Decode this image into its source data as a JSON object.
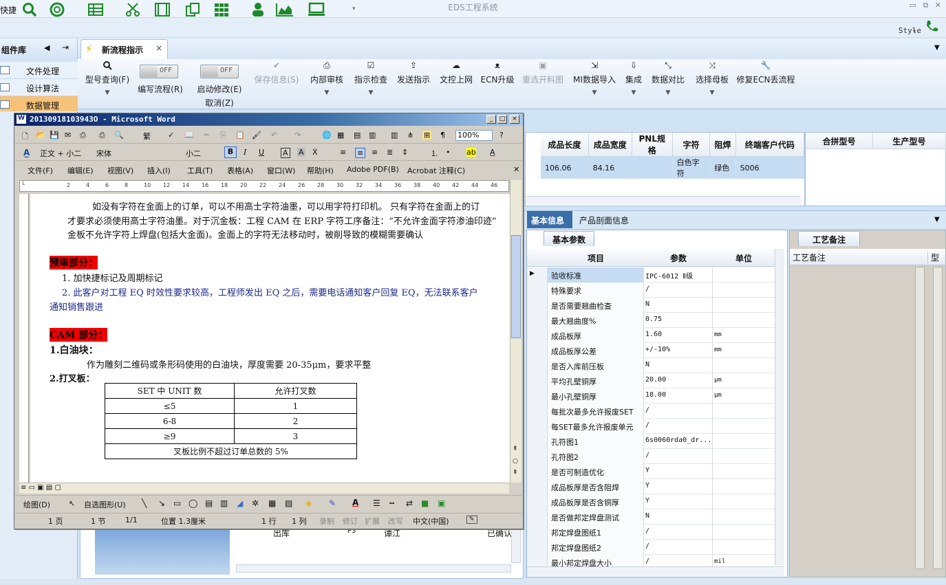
{
  "app": {
    "quick_label": "快捷",
    "title": "EDS工程系统",
    "style_label": "Style"
  },
  "left": {
    "title": "组件库",
    "items": [
      {
        "label": "文件处理"
      },
      {
        "label": "设计算法"
      },
      {
        "label": "数据管理"
      }
    ]
  },
  "tab": {
    "label": "新流程指示"
  },
  "ribbon": {
    "items": [
      {
        "label": "型号查询(F)"
      },
      {
        "label": "编写流程(R)"
      },
      {
        "label": "启动修改(E)",
        "sub": "取消(Z)"
      },
      {
        "label": "保存信息(S)"
      },
      {
        "label": "内部审核"
      },
      {
        "label": "指示检查"
      },
      {
        "label": "发送指示"
      },
      {
        "label": "文控上网"
      },
      {
        "label": "ECN升级"
      },
      {
        "label": "重选开料图"
      },
      {
        "label": "MI数据导入"
      },
      {
        "label": "集成"
      },
      {
        "label": "数据对比"
      },
      {
        "label": "选择母板"
      },
      {
        "label": "修复ECN丢流程"
      }
    ],
    "toggle_off": "OFF"
  },
  "grid1": {
    "headers": [
      "成品长度",
      "成品宽度",
      "PNL规格",
      "字符",
      "阻焊",
      "终端客户代码"
    ],
    "row": [
      "106.06",
      "84.16",
      "",
      "白色字符",
      "绿色",
      "S006"
    ]
  },
  "grid2": {
    "headers": [
      "合拼型号",
      "生产型号"
    ]
  },
  "info_tabs": {
    "basic": "基本信息",
    "profile": "产品剖面信息"
  },
  "props": {
    "tab": "基本参数",
    "headers": {
      "item": "项目",
      "param": "参数",
      "unit": "单位"
    },
    "rows": [
      {
        "n": "验收标准",
        "v": "IPC-6012 Ⅱ级",
        "u": ""
      },
      {
        "n": "特殊要求",
        "v": "/",
        "u": ""
      },
      {
        "n": "是否需要翘曲检查",
        "v": "N",
        "u": ""
      },
      {
        "n": "最大翘曲度%",
        "v": "0.75",
        "u": ""
      },
      {
        "n": "成品板厚",
        "v": "1.60",
        "u": "mm"
      },
      {
        "n": "成品板厚公差",
        "v": "+/-10%",
        "u": "mm"
      },
      {
        "n": "是否入库前压板",
        "v": "N",
        "u": ""
      },
      {
        "n": "平均孔壁铜厚",
        "v": "20.00",
        "u": "μm"
      },
      {
        "n": "最小孔壁铜厚",
        "v": "18.00",
        "u": "μm"
      },
      {
        "n": "每批次最多允许报废SET",
        "v": "/",
        "u": ""
      },
      {
        "n": "每SET最多允许报废单元",
        "v": "/",
        "u": ""
      },
      {
        "n": "孔符图1",
        "v": "6s0060rda0_dr...",
        "u": ""
      },
      {
        "n": "孔符图2",
        "v": "/",
        "u": ""
      },
      {
        "n": "是否可制造优化",
        "v": "Y",
        "u": ""
      },
      {
        "n": "成品板厚是否含阻焊",
        "v": "Y",
        "u": ""
      },
      {
        "n": "成品板厚是否含铜厚",
        "v": "Y",
        "u": ""
      },
      {
        "n": "是否做邦定焊盘测试",
        "v": "N",
        "u": ""
      },
      {
        "n": "邦定焊盘图纸1",
        "v": "/",
        "u": ""
      },
      {
        "n": "邦定焊盘图纸2",
        "v": "/",
        "u": ""
      },
      {
        "n": "最小邦定焊盘大小",
        "v": "/",
        "u": "mil"
      }
    ]
  },
  "craft": {
    "tab": "工艺备注",
    "header": "工艺备注",
    "col2": "型"
  },
  "bg_list": {
    "c1": "出库",
    "c2": "P3",
    "c3": "谭江",
    "c4": "已确认"
  },
  "word": {
    "title": "20130918103943O - Microsoft Word",
    "style_box": "正文 + 小二",
    "font_box": "宋体",
    "size_box": "小二",
    "zoom": "100%",
    "menus": [
      "文件(F)",
      "编辑(E)",
      "视图(V)",
      "插入(I)",
      "工具(T)",
      "表格(A)",
      "窗口(W)",
      "帮助(H)",
      "Adobe PDF(B)",
      "Acrobat 注释(C)"
    ],
    "ruler_marks": [
      "2",
      "4",
      "6",
      "8",
      "10",
      "12",
      "14",
      "16",
      "18",
      "20",
      "22",
      "24",
      "26",
      "28",
      "30",
      "32",
      "34",
      "36",
      "38",
      "40",
      "42",
      "44",
      "46"
    ],
    "body": {
      "p1": "如没有字符在金面上的订单，可以不用高士字符油墨，可以用字符打印机。   只有字符在金面上的订",
      "p2": "才要求必须使用高士字符油墨。对于沉金板：工程 CAM 在 ERP 字符工序备注：“不允许金面字符渗油印迹”",
      "p3": "金板不允许字符上焊盘(包括大金面)。金面上的字符无法移动时，被削导致的模糊需要确认",
      "h1": "预审部分：",
      "l1": "1. 加快捷标记及周期标记",
      "l2": "2. 此客户对工程 EQ 时效性要求较高，工程师发出 EQ 之后，需要电话通知客户回复 EQ，无法联系客户",
      "l2b": "通知销售跟进",
      "h2": "CAM 部分：",
      "s1": "1.白油块：",
      "s1t": "作为雕刻二维码或条形码使用的白油块，厚度需要 20-35μm，要求平整",
      "s2": "2.打叉板：",
      "table": {
        "h": [
          "SET 中 UNIT 数",
          "允许打叉数"
        ],
        "rows": [
          [
            "≤5",
            "1"
          ],
          [
            "6-8",
            "2"
          ],
          [
            "≥9",
            "3"
          ]
        ],
        "foot": "叉板比例不超过订单总数的 5%"
      }
    },
    "draw_label": "绘图(D)",
    "autoshape": "自选图形(U)",
    "status": [
      "1 页",
      "1 节",
      "1/1",
      "位置 1.3厘米",
      "1 行",
      "1 列",
      "录制",
      "修订",
      "扩展",
      "改写",
      "中文(中国)"
    ]
  }
}
